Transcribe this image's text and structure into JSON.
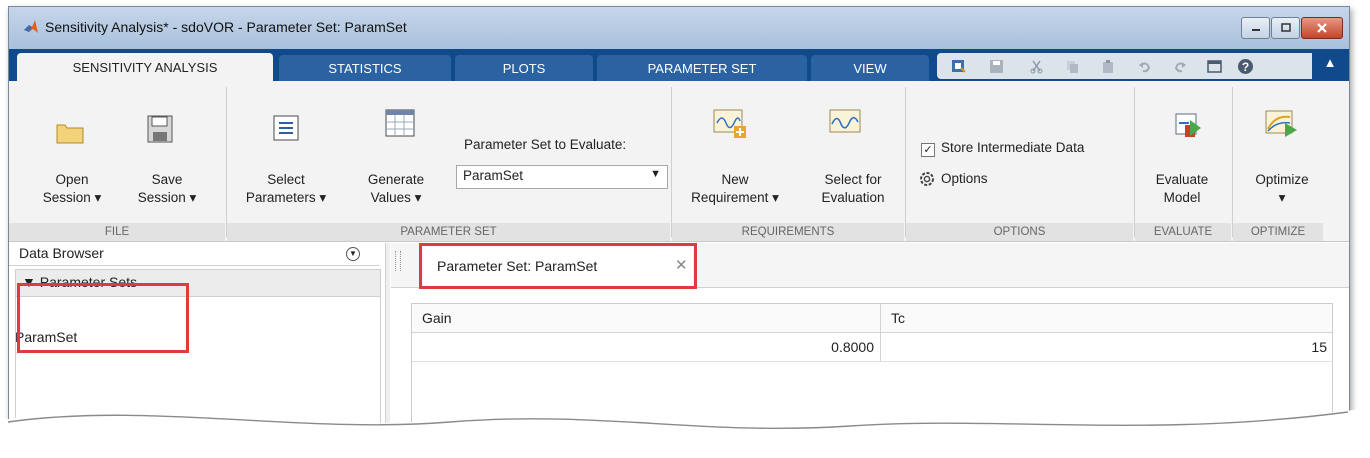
{
  "window": {
    "title": "Sensitivity Analysis* - sdoVOR - Parameter Set:  ParamSet",
    "minimize_icon": "minimize-icon",
    "maximize_icon": "maximize-icon",
    "close_icon": "close-icon"
  },
  "tabs": [
    {
      "label": "SENSITIVITY ANALYSIS",
      "active": true
    },
    {
      "label": "STATISTICS",
      "active": false
    },
    {
      "label": "PLOTS",
      "active": false
    },
    {
      "label": "PARAMETER SET",
      "active": false
    },
    {
      "label": "VIEW",
      "active": false
    }
  ],
  "quick_access": {
    "icons": [
      "new-icon",
      "save-icon",
      "cut-icon",
      "copy-icon",
      "paste-icon",
      "undo-icon",
      "redo-icon",
      "window-icon",
      "help-icon"
    ],
    "collapse_glyph": "▲"
  },
  "ribbon": {
    "file": {
      "section": "FILE",
      "open": {
        "line1": "Open",
        "line2": "Session ▾",
        "icon": "folder-icon"
      },
      "save": {
        "line1": "Save",
        "line2": "Session ▾",
        "icon": "floppy-disk-icon"
      }
    },
    "parameter_set": {
      "section": "PARAMETER SET",
      "select": {
        "line1": "Select",
        "line2": "Parameters ▾",
        "icon": "list-icon"
      },
      "generate": {
        "line1": "Generate",
        "line2": "Values ▾",
        "icon": "grid-icon"
      },
      "combo_label": "Parameter Set to Evaluate:",
      "combo_value": "ParamSet"
    },
    "requirements": {
      "section": "REQUIREMENTS",
      "new": {
        "line1": "New",
        "line2": "Requirement ▾",
        "icon": "new-requirement-icon"
      },
      "select_eval": {
        "line1": "Select for",
        "line2": "Evaluation",
        "icon": "signal-icon"
      }
    },
    "options": {
      "section": "OPTIONS",
      "store_intermediate": "Store Intermediate Data",
      "store_checked": true,
      "options_label": "Options"
    },
    "evaluate": {
      "section": "EVALUATE",
      "btn": {
        "line1": "Evaluate",
        "line2": "Model",
        "icon": "evaluate-icon"
      }
    },
    "optimize": {
      "section": "OPTIMIZE",
      "btn": {
        "line1": "Optimize",
        "line2": "▾",
        "icon": "optimize-icon"
      }
    }
  },
  "data_browser": {
    "title": "Data Browser",
    "group": "▼ Parameter Sets",
    "items": [
      "ParamSet"
    ]
  },
  "document": {
    "tab_label": "Parameter Set:  ParamSet",
    "close_glyph": "✕",
    "table": {
      "columns": [
        "Gain",
        "Tc"
      ],
      "rows": [
        [
          "0.8000",
          "15"
        ]
      ]
    }
  },
  "colors": {
    "tabstrip": "#104a8a",
    "ribbon": "#f3f3f3",
    "highlight": "#e03a3a"
  }
}
